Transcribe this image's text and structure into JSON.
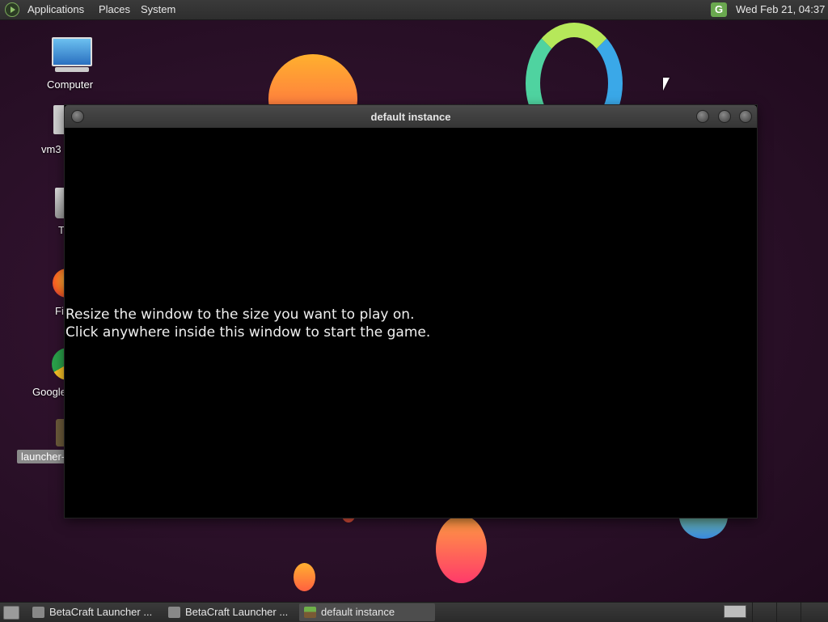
{
  "top_panel": {
    "menus": [
      "Applications",
      "Places",
      "System"
    ],
    "tray_icon": "mint-update-icon",
    "tray_icon_letter": "G",
    "clock": "Wed Feb 21, 04:37"
  },
  "desktop": {
    "icons": [
      {
        "label": "Computer",
        "icon": "computer-icon"
      },
      {
        "label": "vm3",
        "icon": "home-folder-icon"
      },
      {
        "label": "T",
        "icon": "trash-icon"
      },
      {
        "label": "Fi",
        "icon": "firefox-icon"
      },
      {
        "label": "Google",
        "icon": "chrome-icon"
      },
      {
        "label": "launcher-",
        "icon": "launcher-file-icon"
      }
    ]
  },
  "window": {
    "title": "default instance",
    "message_line1": "Resize the window to the size you want to play on.",
    "message_line2": "Click anywhere inside this window to start the game."
  },
  "taskbar": {
    "tasks": [
      {
        "label": "BetaCraft Launcher ...",
        "icon": "betacraft-icon"
      },
      {
        "label": "BetaCraft Launcher ...",
        "icon": "betacraft-icon"
      },
      {
        "label": "default instance",
        "icon": "minecraft-grass-icon",
        "active": true
      }
    ]
  },
  "colors": {
    "desktop_bg": "#2a1028",
    "panel_bg": "#333333",
    "window_content_bg": "#000000",
    "accent_green": "#6aa84f"
  }
}
